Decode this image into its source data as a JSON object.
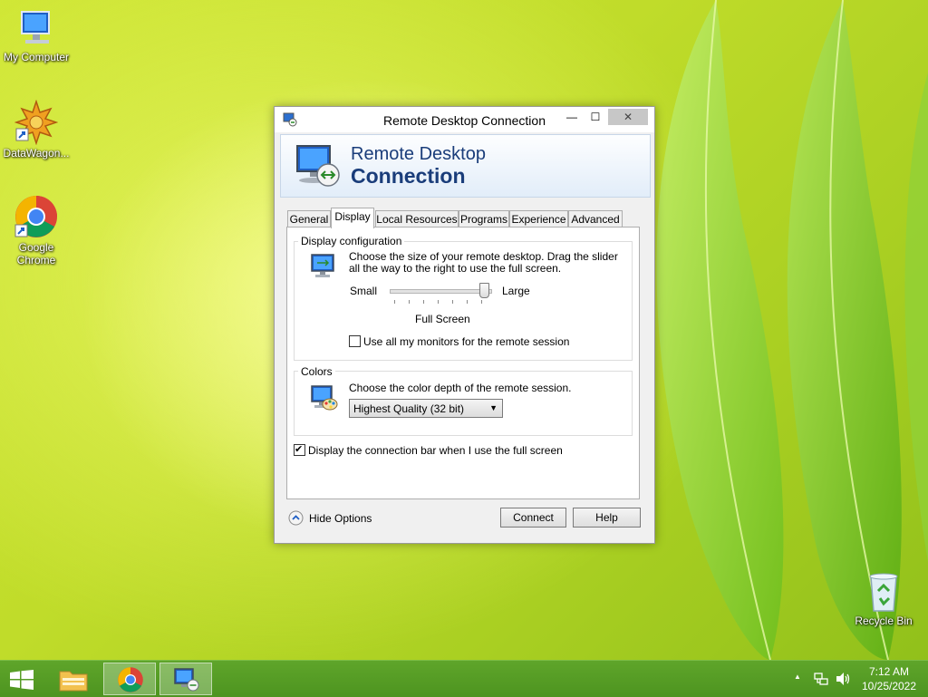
{
  "desktop": {
    "icons": [
      {
        "label": "My Computer"
      },
      {
        "label": "DataWagon..."
      },
      {
        "label": "Google Chrome"
      },
      {
        "label": "Recycle Bin"
      }
    ]
  },
  "window": {
    "title": "Remote Desktop Connection",
    "controls": {
      "minimize": "—",
      "maximize": "☐",
      "close": "✕"
    },
    "banner": {
      "line1": "Remote Desktop",
      "line2": "Connection"
    },
    "tabs": [
      {
        "label": "General"
      },
      {
        "label": "Display"
      },
      {
        "label": "Local Resources"
      },
      {
        "label": "Programs"
      },
      {
        "label": "Experience"
      },
      {
        "label": "Advanced"
      }
    ],
    "active_tab": "Display",
    "display_config": {
      "group_label": "Display configuration",
      "description": "Choose the size of your remote desktop. Drag the slider all the way to the right to use the full screen.",
      "slider": {
        "min_label": "Small",
        "max_label": "Large",
        "value_label": "Full Screen",
        "value": 1.0
      },
      "monitors_checkbox": {
        "label": "Use all my monitors for the remote session",
        "checked": false
      }
    },
    "colors": {
      "group_label": "Colors",
      "description": "Choose the color depth of the remote session.",
      "selected": "Highest Quality (32 bit)"
    },
    "connection_bar_checkbox": {
      "label": "Display the connection bar when I use the full screen",
      "checked": true
    },
    "footer": {
      "hide_options": "Hide Options",
      "connect": "Connect",
      "help": "Help"
    }
  },
  "taskbar": {
    "time": "7:12 AM",
    "date": "10/25/2022",
    "tray_chevron": "▲"
  },
  "colors": {
    "taskbar": "#4d9420",
    "banner_text": "#1a3d7a",
    "rdp_blue": "#2c6fcf"
  }
}
